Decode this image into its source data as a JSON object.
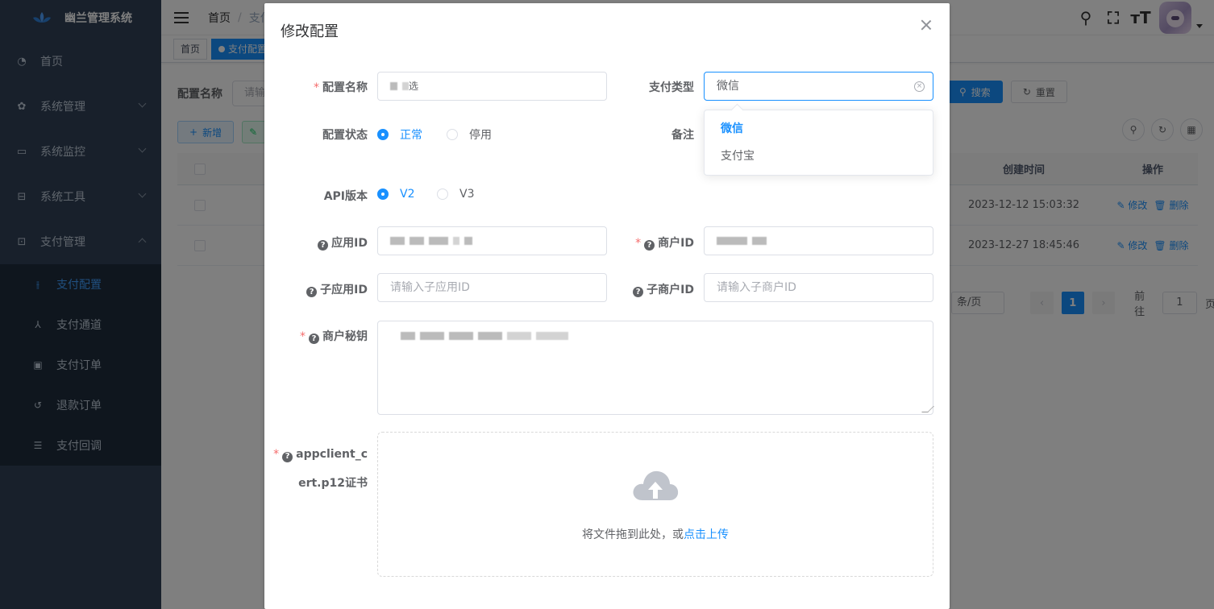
{
  "sidebar": {
    "title": "幽兰管理系统",
    "items": [
      {
        "label": "首页",
        "icon": "dashboard-icon"
      },
      {
        "label": "系统管理",
        "icon": "gear-icon"
      },
      {
        "label": "系统监控",
        "icon": "monitor-icon"
      },
      {
        "label": "系统工具",
        "icon": "toolbox-icon"
      },
      {
        "label": "支付管理",
        "icon": "wallet-icon"
      }
    ],
    "subitems": [
      {
        "label": "支付配置",
        "icon": "sliders-icon",
        "active": true
      },
      {
        "label": "支付通道",
        "icon": "network-icon"
      },
      {
        "label": "支付订单",
        "icon": "order-icon"
      },
      {
        "label": "退款订单",
        "icon": "refund-icon"
      },
      {
        "label": "支付回调",
        "icon": "callback-icon"
      }
    ]
  },
  "navbar": {
    "breadcrumb": [
      "首页",
      "支付"
    ]
  },
  "tags": [
    "首页",
    "支付配置"
  ],
  "search": {
    "label": "配置名称",
    "placeholder": "请输",
    "search_btn": "搜索",
    "reset_btn": "重置"
  },
  "toolbar": {
    "add_btn": "新增"
  },
  "table": {
    "headers": {
      "time": "创建时间",
      "op": "操作"
    },
    "rows": [
      {
        "time": "2023-12-12 15:03:32",
        "edit": "修改",
        "delete": "删除"
      },
      {
        "time": "2023-12-27 18:45:46",
        "edit": "修改",
        "delete": "删除"
      }
    ]
  },
  "pager": {
    "size": "条/页",
    "current": "1",
    "goto_label": "前往",
    "goto_value": "1",
    "page_suffix": "页"
  },
  "dialog": {
    "title": "修改配置",
    "fields": {
      "config_name": {
        "label": "配置名称",
        "value_suffix": "选"
      },
      "pay_type": {
        "label": "支付类型",
        "value": "微信"
      },
      "status": {
        "label": "配置状态",
        "options": [
          "正常",
          "停用"
        ],
        "selected": "正常"
      },
      "remark": {
        "label": "备注"
      },
      "api_version": {
        "label": "API版本",
        "options": [
          "V2",
          "V3"
        ],
        "selected": "V2"
      },
      "app_id": {
        "label": "应用ID"
      },
      "mch_id": {
        "label": "商户ID"
      },
      "sub_app_id": {
        "label": "子应用ID",
        "placeholder": "请输入子应用ID"
      },
      "sub_mch_id": {
        "label": "子商户ID",
        "placeholder": "请输入子商户ID"
      },
      "mch_key": {
        "label": "商户秘钥"
      },
      "cert": {
        "label_line1": "appclient_c",
        "label_line2": "ert.p12证书",
        "upload_text": "将文件拖到此处，或",
        "upload_link": "点击上传"
      }
    }
  },
  "dropdown": {
    "options": [
      "微信",
      "支付宝"
    ],
    "selected": "微信"
  },
  "colors": {
    "primary": "#1890ff",
    "sidebar_bg": "#304156",
    "required": "#f56c6c"
  }
}
